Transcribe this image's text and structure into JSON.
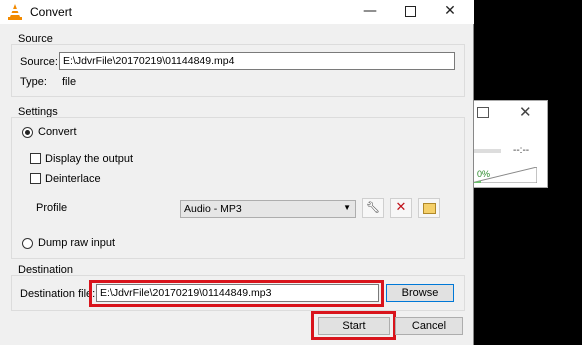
{
  "window": {
    "title": "Convert"
  },
  "source": {
    "group_title": "Source",
    "source_label": "Source:",
    "source_value": "E:\\JdvrFile\\20170219\\01144849.mp4",
    "type_label": "Type:",
    "type_value": "file"
  },
  "settings": {
    "group_title": "Settings",
    "convert_label": "Convert",
    "display_output_label": "Display the output",
    "deinterlace_label": "Deinterlace",
    "profile_label": "Profile",
    "profile_selected": "Audio - MP3",
    "dump_raw_label": "Dump raw input"
  },
  "destination": {
    "group_title": "Destination",
    "file_label": "Destination file:",
    "file_value": "E:\\JdvrFile\\20170219\\01144849.mp3",
    "browse_label": "Browse"
  },
  "buttons": {
    "start": "Start",
    "cancel": "Cancel"
  },
  "background_window": {
    "time": "--:--",
    "volume": "0%"
  },
  "colors": {
    "highlight": "#d9141c",
    "accent": "#0078d7"
  }
}
